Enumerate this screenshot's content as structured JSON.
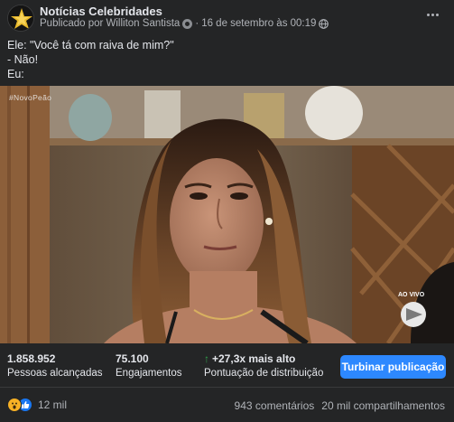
{
  "post": {
    "page_name": "Notícias Celebridades",
    "published_by": "Publicado por Williton Santista",
    "separator": "·",
    "date": "16 de setembro às 00:19",
    "caption_lines": [
      "Ele: \"Você tá com raiva de mim?\"",
      "- Não!",
      "Eu:"
    ]
  },
  "media": {
    "hashtag": "#NovoPeão",
    "live_label": "AO VIVO"
  },
  "stats": {
    "reach_value": "1.858.952",
    "reach_label": "Pessoas alcançadas",
    "engagement_value": "75.100",
    "engagement_label": "Engajamentos",
    "distribution_value": "+27,3x mais alto",
    "distribution_label": "Pontuação de distribuição",
    "boost_label": "Turbinar publicação"
  },
  "footer": {
    "reactions_count": "12 mil",
    "comments": "943 comentários",
    "shares": "20 mil compartilhamentos"
  },
  "colors": {
    "background": "#242526",
    "text_primary": "#e4e6eb",
    "text_secondary": "#b0b3b8",
    "accent_blue": "#2d88ff",
    "positive_green": "#31a24c"
  }
}
